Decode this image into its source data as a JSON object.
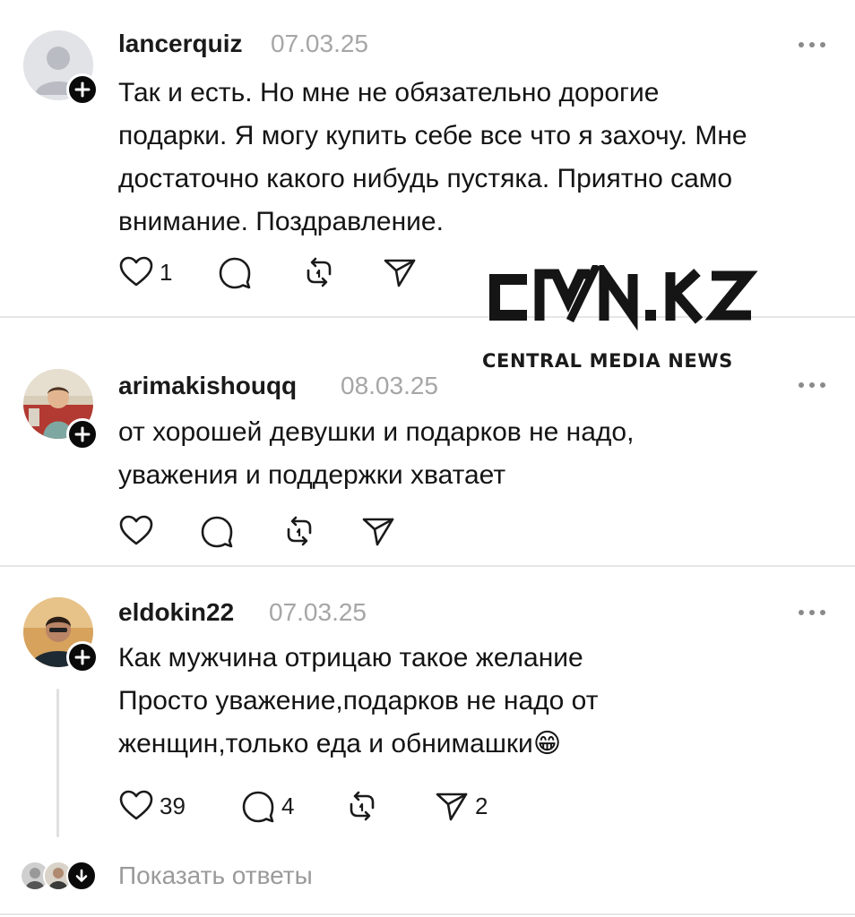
{
  "posts": [
    {
      "username": "lancerquiz",
      "date": "07.03.25",
      "avatar": "default-person-avatar",
      "lines": [
        "Так и есть. Но мне не обязательно дорогие",
        "подарки. Я могу купить себе все что я захочу. Мне",
        "достаточно какого нибудь пустяка. Приятно само",
        "внимание. Поздравление."
      ],
      "likes": "1",
      "replies": "",
      "reposts": "",
      "shares": ""
    },
    {
      "username": "arimakishouqq",
      "date": "08.03.25",
      "avatar": "photo-avatar-child",
      "lines": [
        "от хорошей девушки и подарков не надо,",
        "уважения и поддержки хватает"
      ],
      "likes": "",
      "replies": "",
      "reposts": "",
      "shares": ""
    },
    {
      "username": "eldokin22",
      "date": "07.03.25",
      "avatar": "photo-avatar-man",
      "lines": [
        "Как мужчина отрицаю такое желание",
        "Просто уважение,подарков не надо от",
        "женщин,только еда и обнимашки"
      ],
      "emoji": "😁",
      "likes": "39",
      "replies": "4",
      "reposts": "",
      "shares": "2"
    }
  ],
  "show_replies_label": "Показать ответы",
  "watermark": {
    "logo_text": "CMN.KZ",
    "tagline": "CENTRAL MEDIA NEWS"
  },
  "icons": {
    "like": "heart-icon",
    "reply": "comment-bubble-icon",
    "repost": "repost-icon",
    "share": "send-icon",
    "more": "more-dots-icon",
    "follow": "plus-icon",
    "expand": "arrow-down-icon"
  },
  "colors": {
    "text": "#141414",
    "muted": "#a6a6a6",
    "divider": "#e6e6e6",
    "badge": "#0a0a0a"
  }
}
